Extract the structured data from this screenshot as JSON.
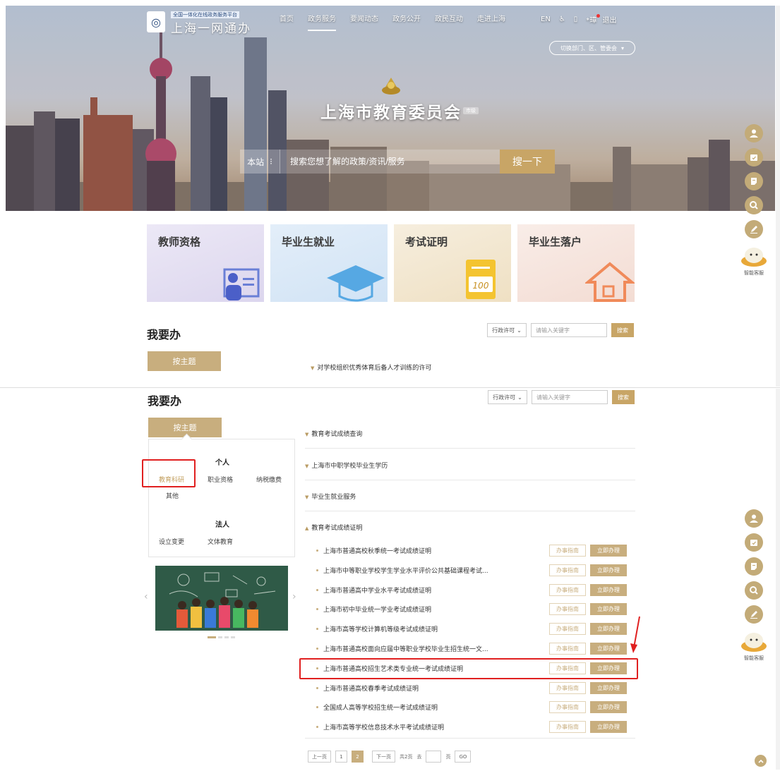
{
  "header": {
    "logo_sub": "全国一体化在线政务服务平台",
    "logo_main": "上海一网通办",
    "nav": [
      "首页",
      "政务服务",
      "要闻动态",
      "政务公开",
      "政民互动",
      "走进上海"
    ],
    "nav_active_index": 1,
    "util": {
      "en": "EN",
      "user": "*璋",
      "logout": "退出"
    },
    "dept_switch": "切换部门、区、管委会"
  },
  "hero": {
    "org_title": "上海市教育委员会",
    "org_tag": "市级",
    "search_scope": "本站",
    "search_placeholder": "搜索您想了解的政策/资讯/服务",
    "search_button": "搜一下"
  },
  "cards": [
    {
      "title": "教师资格"
    },
    {
      "title": "毕业生就业"
    },
    {
      "title": "考试证明"
    },
    {
      "title": "毕业生落户"
    }
  ],
  "card3_badge": "100",
  "todo": {
    "title": "我要办",
    "filter_select": "行政许可",
    "keyword_placeholder": "请输入关键字",
    "search_btn": "搜索",
    "tab_topic": "按主题",
    "first_item": "对学校组织优秀体育后备人才训练的许可"
  },
  "topics": {
    "personal_title": "个人",
    "personal_items": [
      "教育科研",
      "职业资格",
      "纳税缴费",
      "其他"
    ],
    "legal_title": "法人",
    "legal_items": [
      "设立变更",
      "文体教育"
    ]
  },
  "categories": [
    "教育考试成绩查询",
    "上海市中职学校毕业生学历",
    "毕业生就业服务",
    "教育考试成绩证明"
  ],
  "services": [
    "上海市普通高校秋季统一考试成绩证明",
    "上海市中等职业学校学生学业水平评价公共基础课程考试...",
    "上海市普通高中学业水平考试成绩证明",
    "上海市初中毕业统一学业考试成绩证明",
    "上海市高等学校计算机等级考试成绩证明",
    "上海市普通高校面向应届中等职业学校毕业生招生统一文...",
    "上海市普通高校招生艺术类专业统一考试成绩证明",
    "上海市普通高校春季考试成绩证明",
    "全国成人高等学校招生统一考试成绩证明",
    "上海市高等学校信息技术水平考试成绩证明"
  ],
  "service_guide_label": "办事指南",
  "service_apply_label": "立即办理",
  "highlighted_service_index": 6,
  "pager": {
    "prev": "上一页",
    "pages": [
      "1",
      "2"
    ],
    "current": "2",
    "next": "下一页",
    "total": "共2页",
    "goto": "去",
    "unit": "页",
    "go": "GO"
  },
  "float": {
    "bot_label": "智能客服"
  },
  "colors": {
    "accent": "#c8ae7e",
    "highlight": "#e02020"
  }
}
